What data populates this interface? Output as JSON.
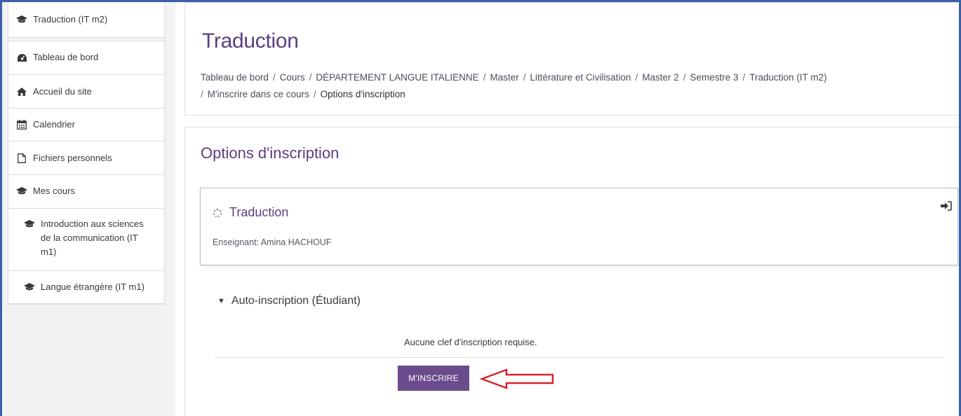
{
  "sidebar": {
    "items": [
      {
        "label": "Traduction (IT m2)",
        "icon": "graduation-cap-icon"
      },
      {
        "label": "Tableau de bord",
        "icon": "dashboard-icon"
      },
      {
        "label": "Accueil du site",
        "icon": "home-icon"
      },
      {
        "label": "Calendrier",
        "icon": "calendar-icon"
      },
      {
        "label": "Fichiers personnels",
        "icon": "file-icon"
      },
      {
        "label": "Mes cours",
        "icon": "graduation-cap-icon"
      },
      {
        "label": "Introduction aux sciences de la communication (IT m1)",
        "icon": "graduation-cap-icon"
      },
      {
        "label": "Langue étrangère (IT m1)",
        "icon": "graduation-cap-icon"
      }
    ]
  },
  "header": {
    "title": "Traduction",
    "breadcrumb": [
      "Tableau de bord",
      "Cours",
      "DÉPARTEMENT LANGUE ITALIENNE",
      "Master",
      "Littérature et Civilisation",
      "Master 2",
      "Semestre 3",
      "Traduction (IT m2)",
      "M'inscrire dans ce cours",
      "Options d'inscription"
    ],
    "separator": "/"
  },
  "main": {
    "section_title": "Options d'inscription",
    "course": {
      "name": "Traduction",
      "teacher": "Enseignant: Amina HACHOUF"
    },
    "self_enrolment": {
      "heading": "Auto-inscription (Étudiant)",
      "message": "Aucune clef d'inscription requise.",
      "button_label": "M'INSCRIRE"
    }
  },
  "colors": {
    "accent": "#6a4b8c",
    "title": "#5b3f7e",
    "arrow": "#d4232a",
    "frame": "#3a5fa8"
  }
}
